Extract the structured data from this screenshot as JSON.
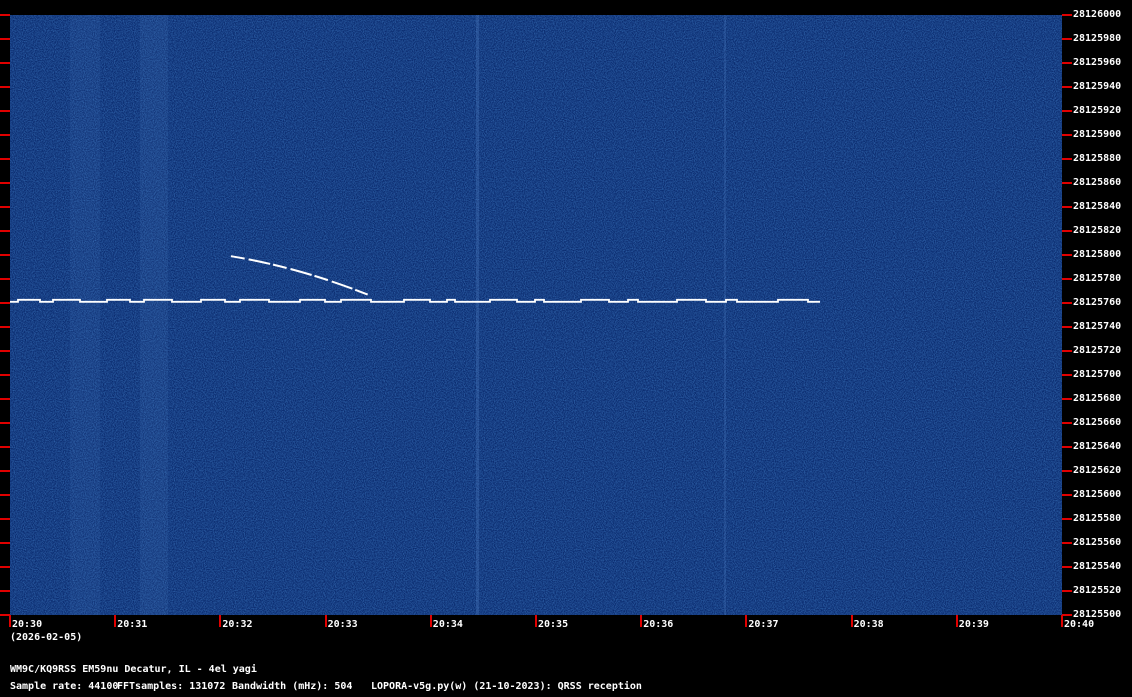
{
  "grabber": {
    "station_line": "WM9C/KQ9RSS EM59nu Decatur, IL - 4el yagi",
    "sample_rate": "Sample rate: 44100",
    "fft_samples": "FFTsamples: 131072",
    "bandwidth": "Bandwidth (mHz): 504",
    "software": "LOPORA-v5g.py(w) (21-10-2023): QRSS reception",
    "date": "(2026-02-05)"
  },
  "chart_data": {
    "type": "heatmap",
    "xlabel": "",
    "ylabel": "",
    "x_tick_labels": [
      "20:30",
      "20:31",
      "20:32",
      "20:33",
      "20:34",
      "20:35",
      "20:36",
      "20:37",
      "20:38",
      "20:39",
      "20:40"
    ],
    "y_tick_labels": [
      "28126000",
      "28125980",
      "28125960",
      "28125940",
      "28125920",
      "28125900",
      "28125880",
      "28125860",
      "28125840",
      "28125820",
      "28125800",
      "28125780",
      "28125760",
      "28125740",
      "28125720",
      "28125700",
      "28125680",
      "28125660",
      "28125640",
      "28125620",
      "28125600",
      "28125580",
      "28125560",
      "28125540",
      "28125520",
      "28125500"
    ],
    "xlim": [
      "20:30",
      "20:40"
    ],
    "ylim": [
      28125500,
      28126000
    ],
    "background_color": "#0a2a6e",
    "trace_color": "#ffffff",
    "tick_color": "#e00000",
    "signals": [
      {
        "kind": "fsk_trace",
        "start": "20:30",
        "end": "20:37.7",
        "frequency_hz": 28125761
      },
      {
        "kind": "drifting_trace",
        "start": "20:32.1",
        "end": "20:33.4",
        "frequency_start_hz": 28125799,
        "frequency_end_hz": 28125767
      }
    ]
  }
}
